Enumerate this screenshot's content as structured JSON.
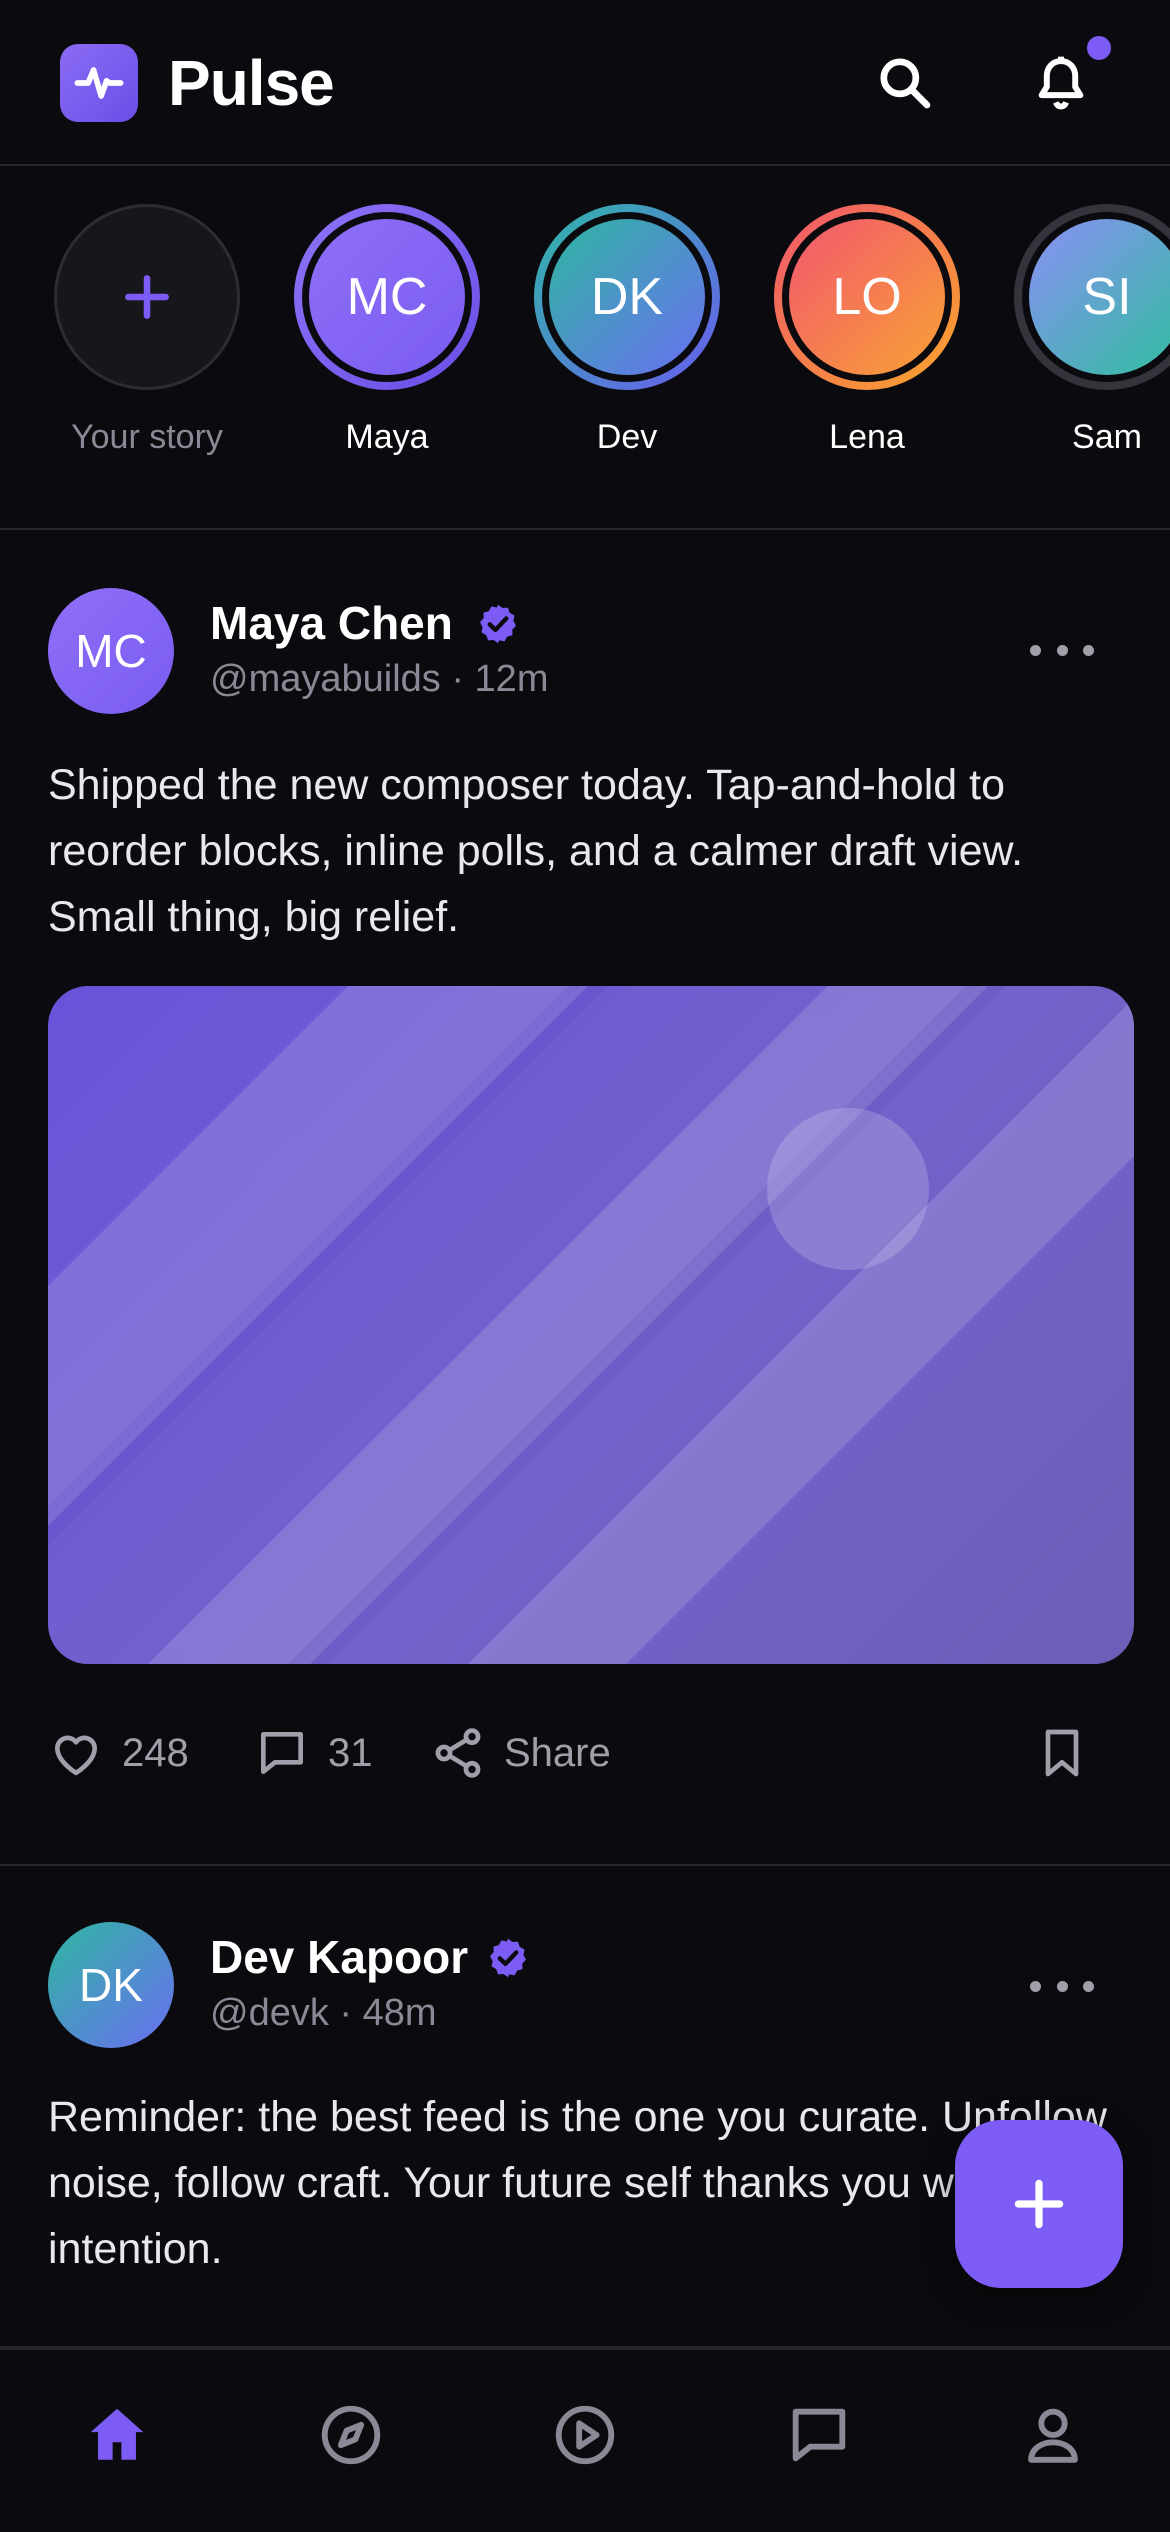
{
  "app": {
    "title": "Pulse"
  },
  "colors": {
    "accent": "#7c5cf5",
    "background": "#0b0b0f",
    "muted": "#8a8a96"
  },
  "header": {
    "icons": [
      "pulse-logo-icon",
      "search-icon",
      "bell-icon"
    ],
    "has_notification": true
  },
  "stories": [
    {
      "label": "Your story",
      "type": "add",
      "icon": "plus-icon"
    },
    {
      "label": "Maya",
      "initials": "MC"
    },
    {
      "label": "Dev",
      "initials": "DK"
    },
    {
      "label": "Lena",
      "initials": "LO"
    },
    {
      "label": "Sam",
      "initials": "SI"
    }
  ],
  "posts": [
    {
      "author": "Maya Chen",
      "initials": "MC",
      "verified": true,
      "handle": "@mayabuilds",
      "time": "12m",
      "meta": "@mayabuilds · 12m",
      "text": "Shipped the new composer today. Tap-and-hold to reorder blocks, inline polls, and a calmer draft view. Small thing, big relief.",
      "has_image": true,
      "likes": "248",
      "comments": "31",
      "share_label": "Share"
    },
    {
      "author": "Dev Kapoor",
      "initials": "DK",
      "verified": true,
      "handle": "@devk",
      "time": "48m",
      "meta": "@devk · 48m",
      "text": "Reminder: the best feed is the one you curate. Unfollow noise, follow craft. Your future self thanks you with intention."
    }
  ],
  "fab": {
    "icon": "plus-icon"
  },
  "bottom_nav": [
    {
      "name": "home",
      "icon": "home-icon",
      "active": true
    },
    {
      "name": "explore",
      "icon": "compass-icon"
    },
    {
      "name": "videos",
      "icon": "play-icon"
    },
    {
      "name": "messages",
      "icon": "chat-icon"
    },
    {
      "name": "profile",
      "icon": "user-icon"
    }
  ]
}
